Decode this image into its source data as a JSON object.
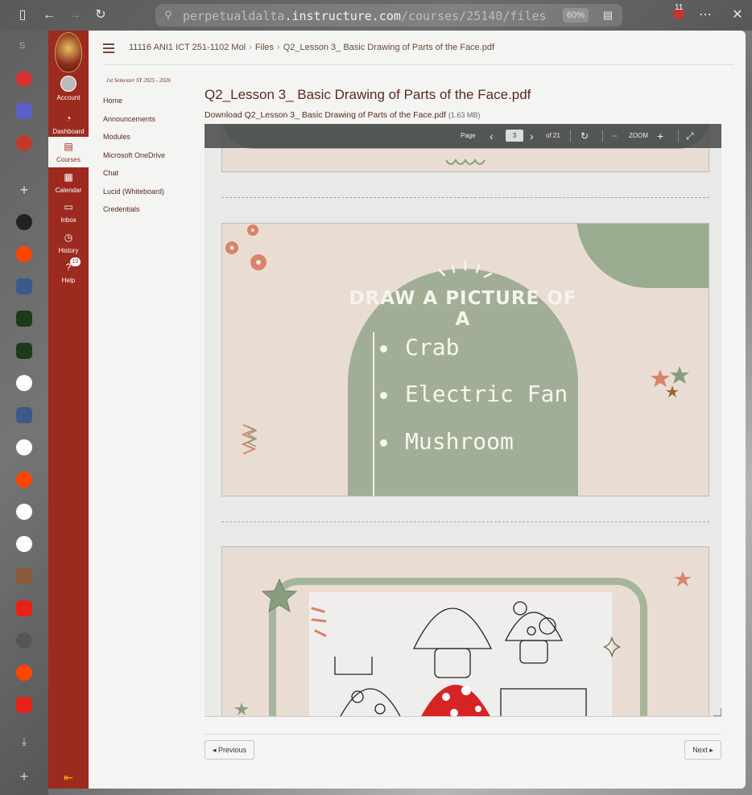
{
  "browser": {
    "url_prefix": "perpetualdalta",
    "url_domain": ".instructure.com",
    "url_path": "/courses/25140/files",
    "zoom": "60%",
    "extension_badge": "11",
    "rail_letter": "S"
  },
  "canvas_nav": {
    "items": [
      {
        "label": "Account"
      },
      {
        "label": "Dashboard"
      },
      {
        "label": "Courses"
      },
      {
        "label": "Calendar"
      },
      {
        "label": "Inbox"
      },
      {
        "label": "History"
      },
      {
        "label": "Help",
        "badge": "10"
      }
    ],
    "active": "Courses"
  },
  "breadcrumb": {
    "course": "11116 ANI1 ICT 251-1102 Mol",
    "section": "Files",
    "file": "Q2_Lesson 3_ Basic Drawing of Parts of the Face.pdf"
  },
  "course_nav": {
    "term": "1st Semester SY 2025 - 2026",
    "links": [
      "Home",
      "Announcements",
      "Modules",
      "Microsoft OneDrive",
      "Chat",
      "Lucid (Whiteboard)",
      "Credentials"
    ]
  },
  "file": {
    "title": "Q2_Lesson 3_ Basic Drawing of Parts of the Face.pdf",
    "download_label": "Download Q2_Lesson 3_ Basic Drawing of Parts of the Face.pdf",
    "size": "(1.63 MB)"
  },
  "viewer": {
    "page_label": "Page",
    "current_page": "3",
    "total_pages": "of 21",
    "zoom_label": "ZOOM"
  },
  "slide": {
    "heading": "DRAW A PICTURE OF A",
    "items": [
      "Crab",
      "Electric Fan",
      "Mushroom"
    ]
  },
  "pagination": {
    "previous": "◂ Previous",
    "next": "Next ▸"
  },
  "colors": {
    "brand": "#9c2a1f",
    "sage": "#a1ae95",
    "slide_bg": "#e9ddd3"
  }
}
